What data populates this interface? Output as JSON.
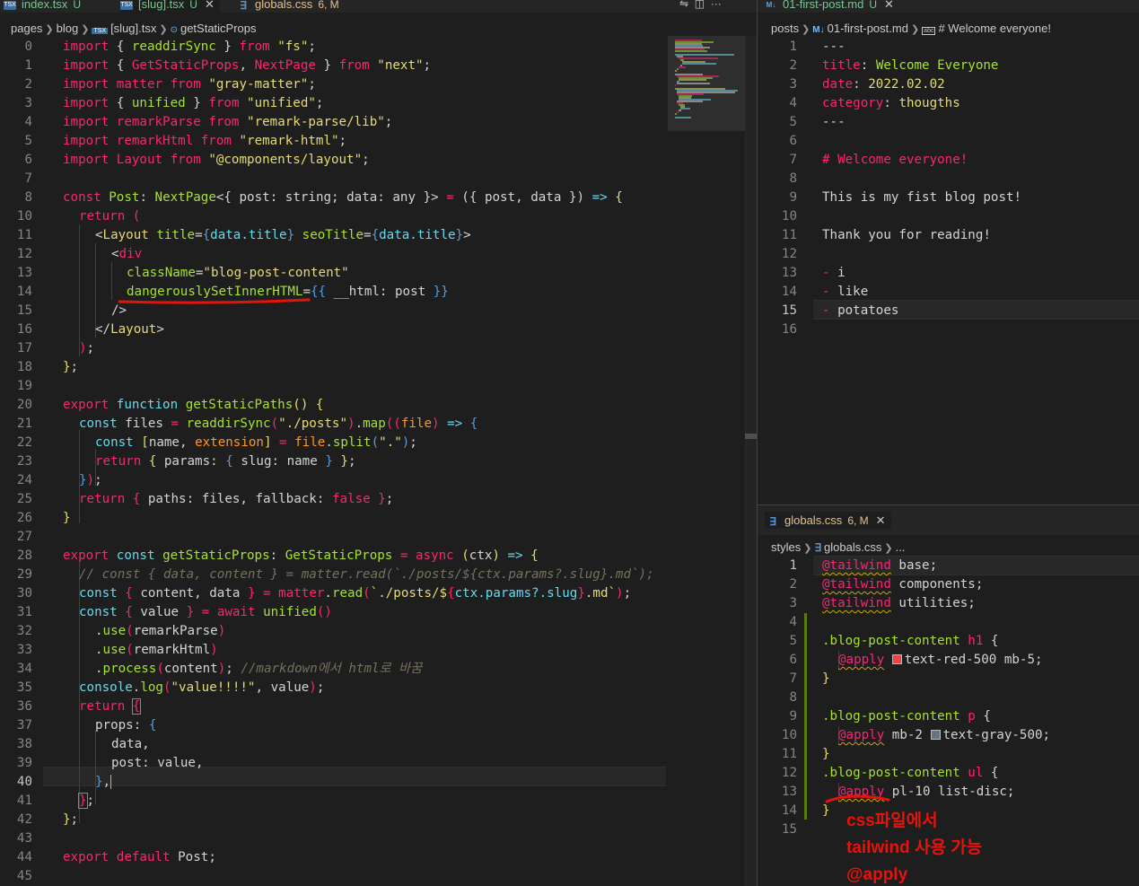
{
  "left_editor": {
    "tabs": [
      {
        "icon": "TSX",
        "label": "index.tsx",
        "status": "U"
      },
      {
        "icon": "TSX",
        "label": "[slug].tsx",
        "status": "U"
      },
      {
        "icon": "css",
        "label": "globals.css",
        "status": "6, M"
      }
    ],
    "breadcrumb": [
      "pages",
      "blog",
      "[slug].tsx",
      "getStaticProps"
    ],
    "active_line": 40
  },
  "right_top_editor": {
    "tab": {
      "label": "01-first-post.md",
      "status": "U"
    },
    "breadcrumb": [
      "posts",
      "01-first-post.md",
      "# Welcome everyone!"
    ],
    "active_line": 15
  },
  "right_bottom_editor": {
    "tab": {
      "label": "globals.css",
      "status": "6, M"
    },
    "breadcrumb": [
      "styles",
      "globals.css",
      "..."
    ],
    "active_line": 1
  },
  "annotation": {
    "lines": [
      "css파일에서",
      "tailwind 사용 가능",
      "@apply"
    ],
    "color": "#e8120c"
  },
  "colors": {
    "keyword": "#f92672",
    "string": "#e6db74",
    "function": "#a6e22e",
    "param": "#fd971f",
    "comment": "#75715e",
    "type": "#66d9ef"
  }
}
